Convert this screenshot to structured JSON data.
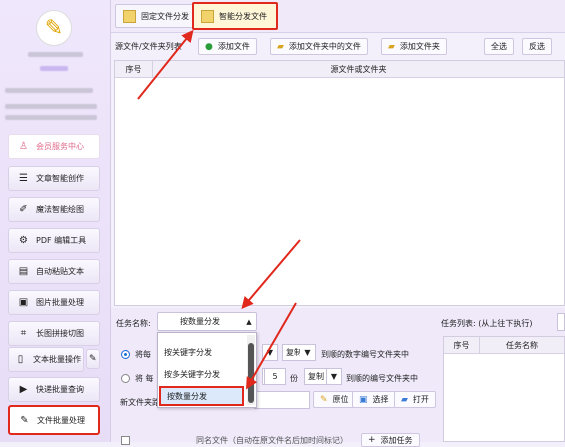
{
  "sidebar": {
    "logo_icon": "star-logo-icon",
    "member_center": "会员服务中心",
    "items": [
      {
        "icon": "text-lines-icon",
        "label": "文章智能创作"
      },
      {
        "icon": "brush-icon",
        "label": "魔法智能绘图"
      },
      {
        "icon": "pdf-gear-icon",
        "label": "PDF 编辑工具"
      },
      {
        "icon": "paste-icon",
        "label": "自动粘贴文本"
      },
      {
        "icon": "image-icon",
        "label": "图片批量处理"
      },
      {
        "icon": "stitch-icon",
        "label": "长图拼接切图"
      },
      {
        "icon": "document-icon",
        "label": "文本批量操作"
      },
      {
        "icon": "video-icon",
        "label": "快递批量查询"
      },
      {
        "icon": "folder-edit-icon",
        "label": "文件批量处理"
      }
    ]
  },
  "tabs": [
    {
      "label": "固定文件分发",
      "icon": "folder-icon"
    },
    {
      "label": "智能分发文件",
      "icon": "folder-icon"
    }
  ],
  "list": {
    "label": "源文件/文件夹列表",
    "add_file": "添加文件",
    "add_folder_files": "添加文件夹中的文件",
    "add_folder": "添加文件夹",
    "select_all": "全选",
    "invert": "反选",
    "col_index": "序号",
    "col_source": "源文件或文件夹"
  },
  "task": {
    "name_label": "任务名称:",
    "name_value": "按数量分发",
    "options": [
      "按关键字分发",
      "按多关键字分发",
      "按数量分发"
    ],
    "row1_prefix": "将每",
    "copy_mode": "复制",
    "row1_suffix": "到顺的数字编号文件夹中",
    "row2_prefix": "将 每",
    "count": "5",
    "unit": "份",
    "row2_suffix": "到顺的编号文件夹中",
    "new_folder_label": "新文件夹路",
    "origin_btn": "原位",
    "choose_btn": "选择",
    "open_btn": "打开",
    "list_label": "任务列表: (从上往下执行)",
    "col_index": "序号",
    "col_name": "任务名称",
    "bottom_text": "同名文件（自动在原文件名后加时间标记）",
    "add_task": "添加任务"
  },
  "colors": {
    "highlight": "#e0281c",
    "accent": "#1f6fd8"
  }
}
